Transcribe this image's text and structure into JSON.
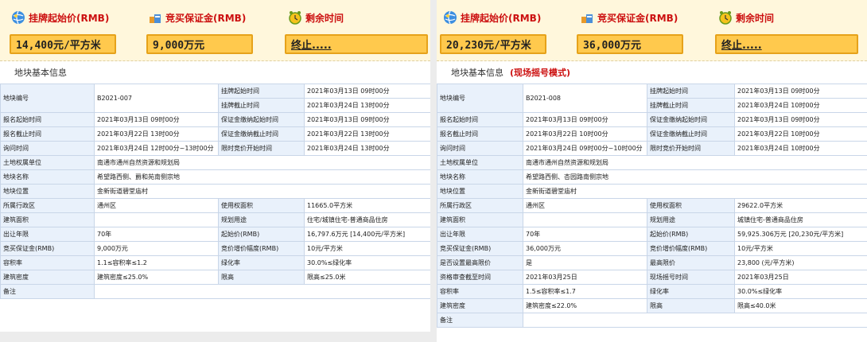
{
  "colors": {
    "accent_red": "#cc1010",
    "box_fill": "#ffc94d",
    "box_border": "#e6a21a",
    "banner_bg": "#fff7dc",
    "key_cell": "#e9f1fb"
  },
  "left": {
    "banner": {
      "start_price_label": "挂牌起始价(RMB)",
      "deposit_label": "竞买保证金(RMB)",
      "time_label": "剩余时间",
      "start_price_value": "14,400元/平方米",
      "deposit_value": "9,000万元",
      "time_value": "终止....."
    },
    "section_title": "地块基本信息",
    "section_mode": "",
    "rows": [
      [
        "地块编号",
        "B2021-007",
        "挂牌起始时间",
        "2021年03月13日 09时00分"
      ],
      [
        "",
        "",
        "挂牌截止时间",
        "2021年03月24日 13时00分"
      ],
      [
        "报名起始时间",
        "2021年03月13日 09时00分",
        "保证金缴纳起始时间",
        "2021年03月13日 09时00分"
      ],
      [
        "报名截止时间",
        "2021年03月22日 13时00分",
        "保证金缴纳截止时间",
        "2021年03月22日 13时00分"
      ],
      [
        "询问时间",
        "2021年03月24日 12时00分~13时00分",
        "限时竞价开始时间",
        "2021年03月24日 13时00分"
      ],
      [
        "土地权属单位",
        "南通市通州自然资源和规划局",
        "",
        ""
      ],
      [
        "地块名称",
        "希望路西侧、爵和苑南侧宗地",
        "",
        ""
      ],
      [
        "地块位置",
        "金新街道碧堂庙村",
        "",
        ""
      ],
      [
        "所属行政区",
        "通州区",
        "使用权面积",
        "11665.0平方米"
      ],
      [
        "建筑面积",
        "",
        "规划用途",
        "住宅/城镇住宅-普通商品住房"
      ],
      [
        "出让年限",
        "70年",
        "起始价(RMB)",
        "16,797.6万元 [14,400元/平方米]"
      ],
      [
        "竞买保证金(RMB)",
        "9,000万元",
        "竞价增价幅度(RMB)",
        "10元/平方米"
      ],
      [
        "容积率",
        "1.1≤容积率≤1.2",
        "绿化率",
        "30.0%≤绿化率"
      ],
      [
        "建筑密度",
        "建筑密度≤25.0%",
        "限高",
        "限高≤25.0米"
      ],
      [
        "备注",
        "",
        "",
        ""
      ]
    ]
  },
  "right": {
    "banner": {
      "start_price_label": "挂牌起始价(RMB)",
      "deposit_label": "竞买保证金(RMB)",
      "time_label": "剩余时间",
      "start_price_value": "20,230元/平方米",
      "deposit_value": "36,000万元",
      "time_value": "终止....."
    },
    "section_title": "地块基本信息",
    "section_mode": "(现场摇号模式)",
    "rows": [
      [
        "地块编号",
        "B2021-008",
        "挂牌起始时间",
        "2021年03月13日 09时00分"
      ],
      [
        "",
        "",
        "挂牌截止时间",
        "2021年03月24日 10时00分"
      ],
      [
        "报名起始时间",
        "2021年03月13日 09时00分",
        "保证金缴纳起始时间",
        "2021年03月13日 09时00分"
      ],
      [
        "报名截止时间",
        "2021年03月22日 10时00分",
        "保证金缴纳截止时间",
        "2021年03月22日 10时00分"
      ],
      [
        "询问时间",
        "2021年03月24日 09时00分~10时00分",
        "限时竞价开始时间",
        "2021年03月24日 10时00分"
      ],
      [
        "土地权属单位",
        "南通市通州自然资源和规划局",
        "",
        ""
      ],
      [
        "地块名称",
        "希望路西侧、杏园路南侧宗地",
        "",
        ""
      ],
      [
        "地块位置",
        "金新街道碧堂庙村",
        "",
        ""
      ],
      [
        "所属行政区",
        "通州区",
        "使用权面积",
        "29622.0平方米"
      ],
      [
        "建筑面积",
        "",
        "规划用途",
        "城镇住宅-普通商品住房"
      ],
      [
        "出让年限",
        "70年",
        "起始价(RMB)",
        "59,925.306万元 [20,230元/平方米]"
      ],
      [
        "竞买保证金(RMB)",
        "36,000万元",
        "竞价增价幅度(RMB)",
        "10元/平方米"
      ],
      [
        "是否设置最高限价",
        "是",
        "最高限价",
        "23,800 (元/平方米)"
      ],
      [
        "资格审查截至时间",
        "2021年03月25日",
        "现场摇号时间",
        "2021年03月25日"
      ],
      [
        "容积率",
        "1.5≤容积率≤1.7",
        "绿化率",
        "30.0%≤绿化率"
      ],
      [
        "建筑密度",
        "建筑密度≤22.0%",
        "限高",
        "限高≤40.0米"
      ],
      [
        "备注",
        "",
        "",
        ""
      ]
    ]
  }
}
